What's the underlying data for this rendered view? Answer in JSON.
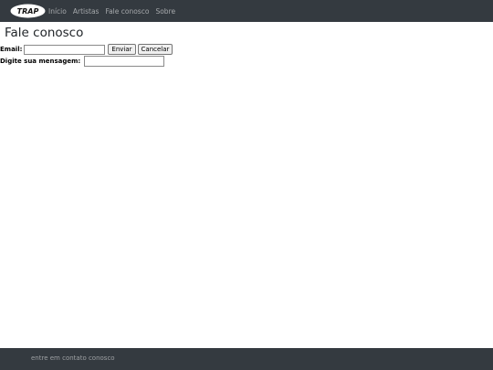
{
  "navbar": {
    "logo_text": "TRAP",
    "links": [
      {
        "label": "Início"
      },
      {
        "label": "Artistas"
      },
      {
        "label": "Fale conosco"
      },
      {
        "label": "Sobre"
      }
    ]
  },
  "main": {
    "title": "Fale conosco",
    "form": {
      "email_label": "Email:",
      "email_value": "",
      "submit_label": "Enviar",
      "cancel_label": "Cancelar",
      "message_label": "Digite sua mensagem:",
      "message_value": ""
    }
  },
  "footer": {
    "text": "entre em contato conosco"
  },
  "colors": {
    "navbar_bg": "#343a40",
    "footer_bg": "#343a40",
    "page_bg": "#ffffff"
  }
}
